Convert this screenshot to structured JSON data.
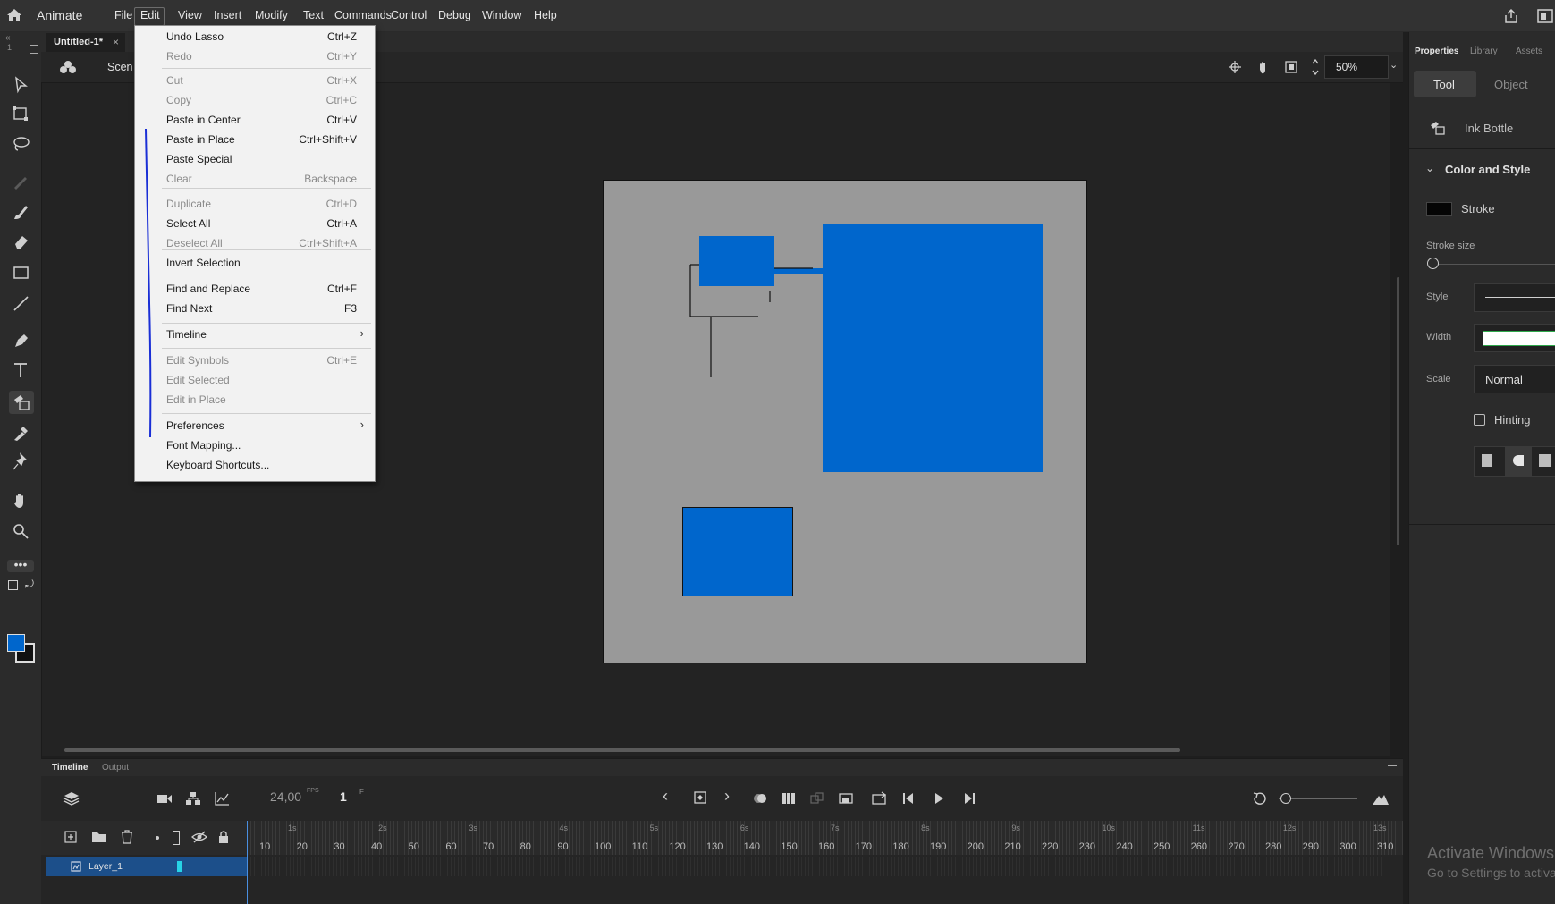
{
  "app": {
    "name": "Animate"
  },
  "menus": [
    "File",
    "Edit",
    "View",
    "Insert",
    "Modify",
    "Text",
    "Commands",
    "Control",
    "Debug",
    "Window",
    "Help"
  ],
  "document": {
    "tab": "Untitled-1*",
    "close": "×"
  },
  "scene": {
    "label": "Scen"
  },
  "view": {
    "zoom": "50%"
  },
  "edit_menu": [
    {
      "label": "Undo Lasso",
      "shortcut": "Ctrl+Z",
      "enabled": true
    },
    {
      "label": "Redo",
      "shortcut": "Ctrl+Y",
      "enabled": false
    },
    {
      "label": "Cut",
      "shortcut": "Ctrl+X",
      "enabled": false
    },
    {
      "label": "Copy",
      "shortcut": "Ctrl+C",
      "enabled": false
    },
    {
      "label": "Paste in Center",
      "shortcut": "Ctrl+V",
      "enabled": true
    },
    {
      "label": "Paste in Place",
      "shortcut": "Ctrl+Shift+V",
      "enabled": true
    },
    {
      "label": "Paste Special",
      "shortcut": "",
      "enabled": true
    },
    {
      "label": "Clear",
      "shortcut": "Backspace",
      "enabled": false
    },
    {
      "label": "Duplicate",
      "shortcut": "Ctrl+D",
      "enabled": false
    },
    {
      "label": "Select All",
      "shortcut": "Ctrl+A",
      "enabled": true
    },
    {
      "label": "Deselect All",
      "shortcut": "Ctrl+Shift+A",
      "enabled": false
    },
    {
      "label": "Invert Selection",
      "shortcut": "",
      "enabled": true
    },
    {
      "label": "Find and Replace",
      "shortcut": "Ctrl+F",
      "enabled": true
    },
    {
      "label": "Find Next",
      "shortcut": "F3",
      "enabled": true
    },
    {
      "label": "Timeline",
      "shortcut": "",
      "enabled": true,
      "submenu": true
    },
    {
      "label": "Edit Symbols",
      "shortcut": "Ctrl+E",
      "enabled": false
    },
    {
      "label": "Edit Selected",
      "shortcut": "",
      "enabled": false
    },
    {
      "label": "Edit in Place",
      "shortcut": "",
      "enabled": false
    },
    {
      "label": "Preferences",
      "shortcut": "",
      "enabled": true,
      "submenu": true
    },
    {
      "label": "Font Mapping...",
      "shortcut": "",
      "enabled": true
    },
    {
      "label": "Keyboard Shortcuts...",
      "shortcut": "",
      "enabled": true
    }
  ],
  "timeline": {
    "tabs": [
      "Timeline",
      "Output"
    ],
    "fps": "24,00",
    "fps_unit": "FPS",
    "frame": "1",
    "frame_unit": "F",
    "layer": "Layer_1",
    "seconds": [
      "1s",
      "2s",
      "3s",
      "4s",
      "5s",
      "6s",
      "7s",
      "8s",
      "9s",
      "10s",
      "11s",
      "12s",
      "13s"
    ],
    "frames": [
      "10",
      "20",
      "30",
      "40",
      "50",
      "60",
      "70",
      "80",
      "90",
      "100",
      "110",
      "120",
      "130",
      "140",
      "150",
      "160",
      "170",
      "180",
      "190",
      "200",
      "210",
      "220",
      "230",
      "240",
      "250",
      "260",
      "270",
      "280",
      "290",
      "300",
      "310"
    ]
  },
  "properties": {
    "tabs": [
      "Properties",
      "Library",
      "Assets"
    ],
    "mode_tabs": [
      "Tool",
      "Object"
    ],
    "tool_name": "Ink Bottle",
    "section": "Color and Style",
    "stroke_label": "Stroke",
    "stroke_size_label": "Stroke size",
    "style_label": "Style",
    "width_label": "Width",
    "scale_label": "Scale",
    "scale_value": "Normal",
    "hinting_label": "Hinting"
  },
  "watermark": {
    "line1": "Activate Windows",
    "line2": "Go to Settings to activate Windows."
  },
  "colors": {
    "fill": "#0066cc",
    "stage": "#999999",
    "accent": "#1473e6"
  }
}
